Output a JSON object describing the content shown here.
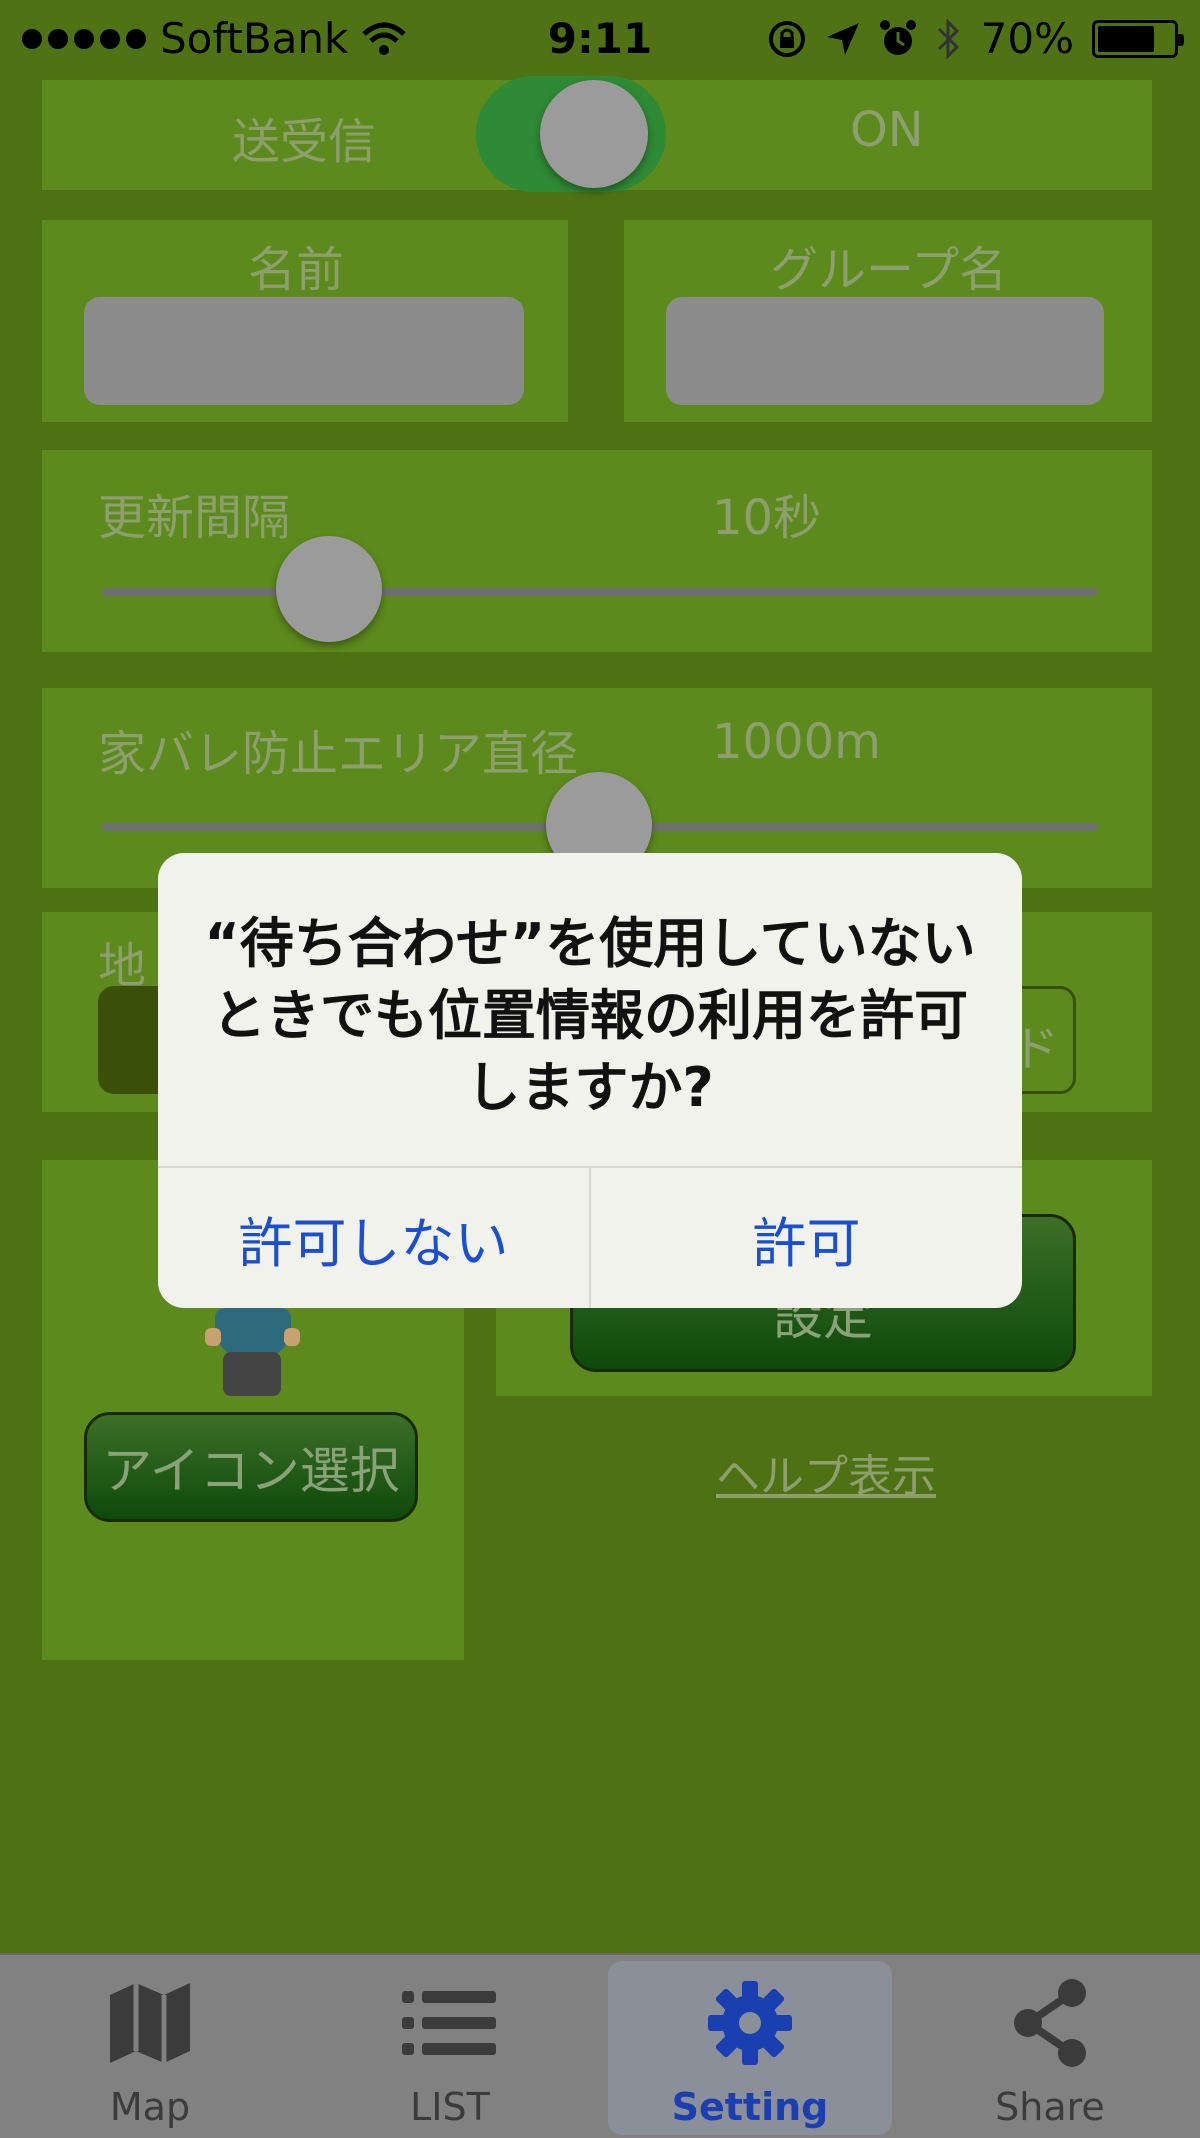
{
  "status_bar": {
    "carrier": "SoftBank",
    "time": "9:11",
    "battery": "70%"
  },
  "settings": {
    "send_receive_label": "送受信",
    "send_receive_state": "ON",
    "name_label": "名前",
    "group_name_label": "グループ名",
    "update_interval_label": "更新間隔",
    "update_interval_value": "10秒",
    "home_area_label": "家バレ防止エリア直径",
    "home_area_value": "1000m",
    "map_label_partial": "地",
    "right_btn_partial": "ド",
    "icon_select_button": "アイコン選択",
    "set_button_partial": "設定",
    "help_link": "ヘルプ表示"
  },
  "dialog": {
    "message": "“待ち合わせ”を使用していないときでも位置情報の利用を許可しますか?",
    "deny_button": "許可しない",
    "allow_button": "許可"
  },
  "tabbar": {
    "tabs": [
      {
        "label": "Map",
        "icon": "map-icon"
      },
      {
        "label": "LIST",
        "icon": "list-icon"
      },
      {
        "label": "Setting",
        "icon": "gear-icon",
        "selected": true
      },
      {
        "label": "Share",
        "icon": "share-icon"
      }
    ]
  },
  "colors": {
    "background": "#4e7213",
    "panel": "#5d8a1c",
    "accent_blue": "#1a4fd2",
    "toggle_on": "#2e8a35"
  }
}
